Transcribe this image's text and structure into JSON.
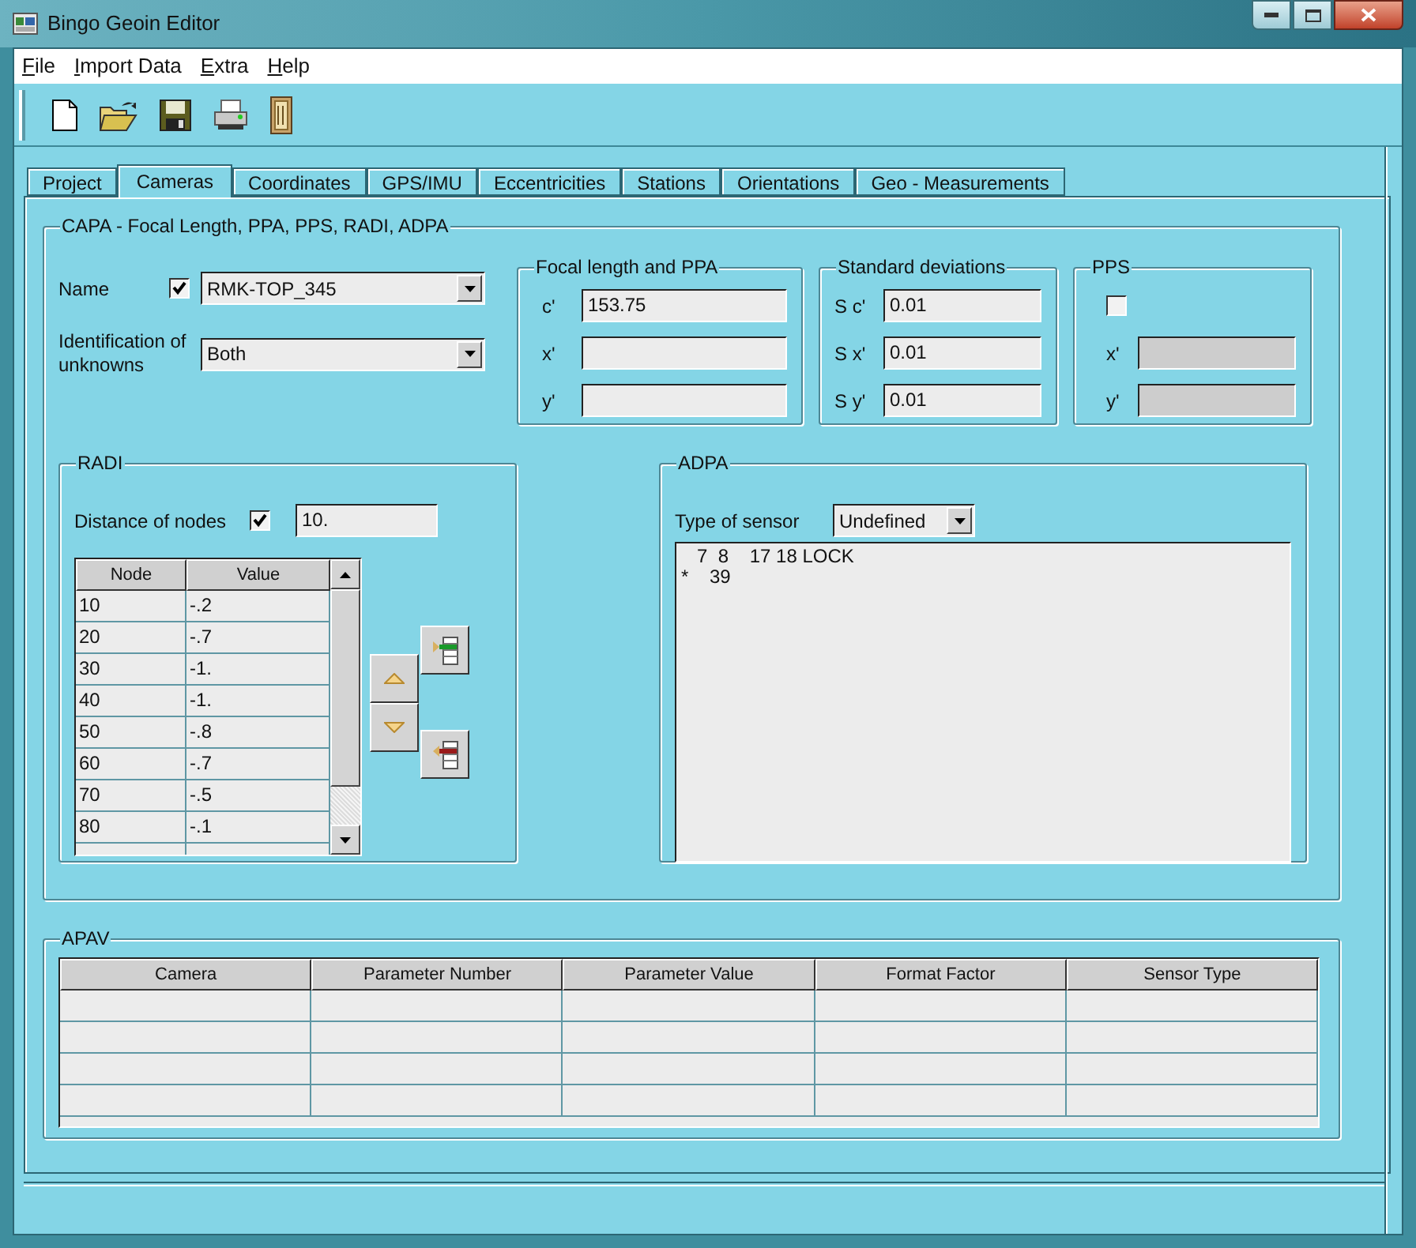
{
  "window": {
    "title": "Bingo Geoin Editor"
  },
  "menu": [
    {
      "label": "File"
    },
    {
      "label": "Import Data"
    },
    {
      "label": "Extra"
    },
    {
      "label": "Help"
    }
  ],
  "tabs": [
    {
      "label": "Project",
      "selected": false
    },
    {
      "label": "Cameras",
      "selected": true
    },
    {
      "label": "Coordinates",
      "selected": false
    },
    {
      "label": "GPS/IMU",
      "selected": false
    },
    {
      "label": "Eccentricities",
      "selected": false
    },
    {
      "label": "Stations",
      "selected": false
    },
    {
      "label": "Orientations",
      "selected": false
    },
    {
      "label": "Geo - Measurements",
      "selected": false
    }
  ],
  "capa": {
    "title": "CAPA - Focal Length, PPA, PPS, RADI, ADPA",
    "name": {
      "label": "Name",
      "checked": true,
      "value": "RMK-TOP_345"
    },
    "identification": {
      "label": "Identification of unknowns",
      "value": "Both"
    },
    "focal": {
      "title": "Focal length and PPA",
      "fields": [
        {
          "label": "c'",
          "value": "153.75"
        },
        {
          "label": "x'"
        },
        {
          "label": "y'"
        }
      ]
    },
    "deviations": {
      "title": "Standard deviations",
      "fields": [
        {
          "label": "S c'",
          "value": "0.01"
        },
        {
          "label": "S x'",
          "value": "0.01"
        },
        {
          "label": "S y'",
          "value": "0.01"
        }
      ]
    },
    "pps": {
      "title": "PPS",
      "checked": false,
      "fields": [
        {
          "label": "x'",
          "disabled": true
        },
        {
          "label": "y'",
          "disabled": true
        }
      ]
    },
    "radi": {
      "title": "RADI",
      "distance": {
        "label": "Distance of nodes",
        "checked": true,
        "value": "10."
      },
      "table": {
        "columns": [
          "Node",
          "Value"
        ],
        "rows": [
          [
            "10",
            "-.2"
          ],
          [
            "20",
            "-.7"
          ],
          [
            "30",
            "-1."
          ],
          [
            "40",
            "-1."
          ],
          [
            "50",
            "-.8"
          ],
          [
            "60",
            "-.7"
          ],
          [
            "70",
            "-.5"
          ],
          [
            "80",
            "-.1"
          ]
        ]
      }
    },
    "adpa": {
      "title": "ADPA",
      "sensor": {
        "label": "Type of sensor",
        "value": "Undefined"
      },
      "lines": [
        "   7  8    17 18 LOCK",
        "*    39"
      ]
    }
  },
  "apav": {
    "title": "APAV",
    "columns": [
      "Camera",
      "Parameter Number",
      "Parameter Value",
      "Format Factor",
      "Sensor Type"
    ]
  }
}
